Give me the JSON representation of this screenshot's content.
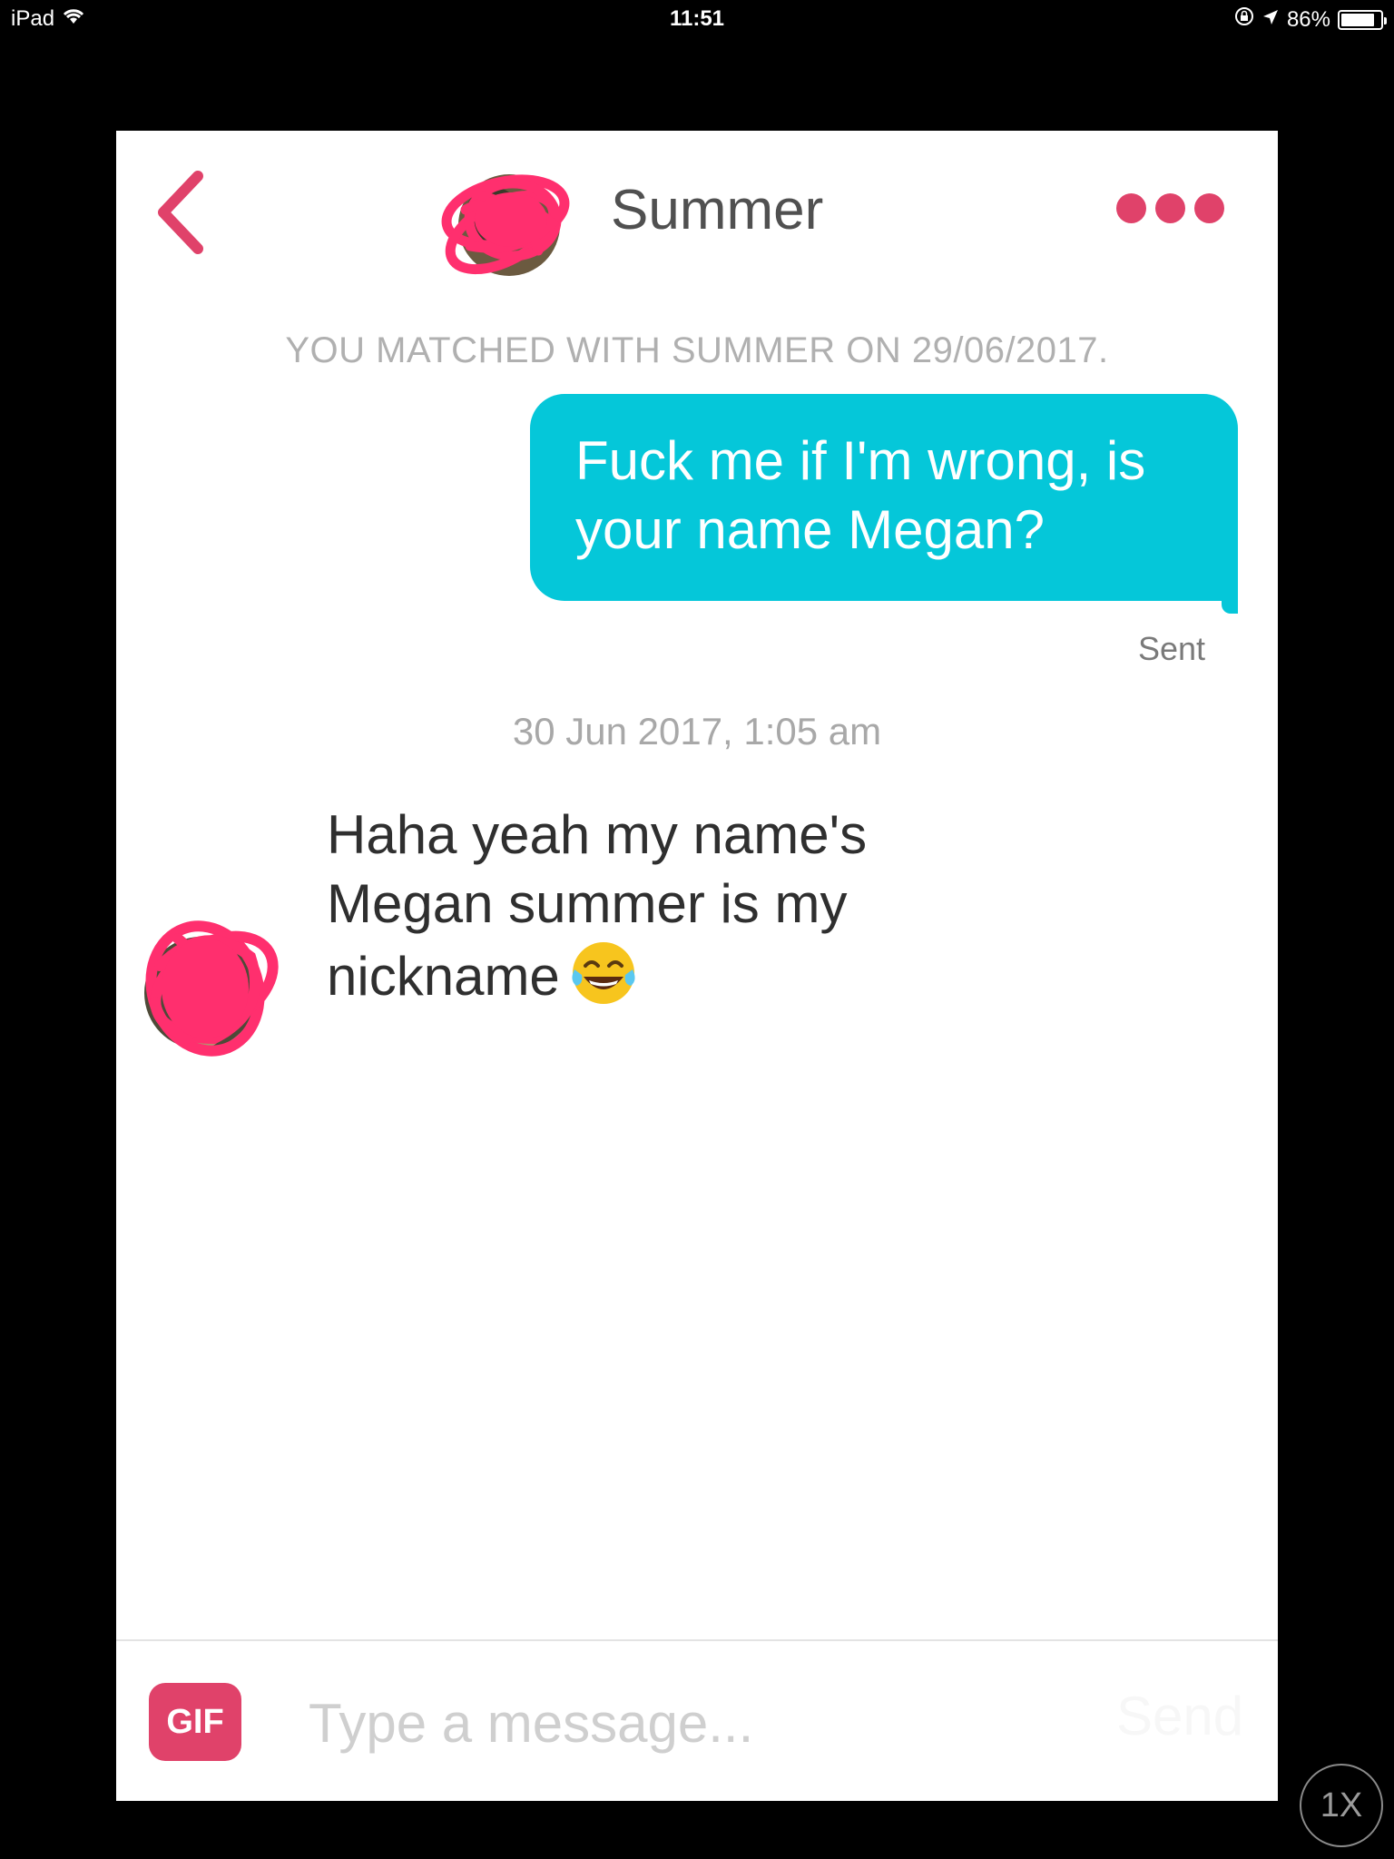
{
  "status_bar": {
    "device": "iPad",
    "time": "11:51",
    "battery": "86%",
    "battery_level": 0.86
  },
  "header": {
    "back_icon": "chevron-left-icon",
    "contact_name": "Summer",
    "more_icon": "more-dots-icon",
    "accent_color": "#e0426a"
  },
  "chat": {
    "match_notice": "YOU MATCHED WITH SUMMER ON 29/06/2017.",
    "outgoing_message": "Fuck me if I'm wrong, is your name Megan?",
    "outgoing_bubble_color": "#05c7d9",
    "sent_label": "Sent",
    "timestamp": "30 Jun 2017, 1:05 am",
    "incoming_message": "Haha yeah my name's Megan summer is my nickname",
    "incoming_emoji": "face-with-tears-of-joy-icon"
  },
  "composer": {
    "gif_label": "GIF",
    "placeholder": "Type a message...",
    "send_label": "Send"
  },
  "playback": {
    "speed_label": "1X"
  }
}
